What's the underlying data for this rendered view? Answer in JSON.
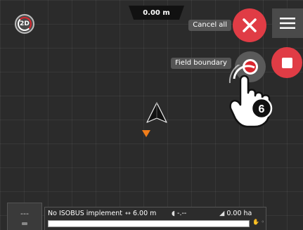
{
  "top": {
    "mode_label": "2D",
    "distance": "0.00 m"
  },
  "actions": {
    "cancel_label": "Cancel all",
    "field_boundary_label": "Field boundary",
    "step_badge": "6"
  },
  "left_panel": {
    "value": "---"
  },
  "status_bar": {
    "implement": "No ISOBUS implement",
    "width": "6.00 m",
    "rate": "-.--",
    "area": "0.00 ha",
    "progress": 0.0
  },
  "colors": {
    "accent_red": "#e03c45",
    "vehicle_marker": "#f07d1a"
  },
  "icons": [
    "2d-mode-icon",
    "close-icon",
    "menu-icon",
    "record-icon",
    "stop-icon",
    "hand-pointer-icon",
    "vehicle-arrow-icon",
    "width-icon",
    "rate-icon",
    "area-icon"
  ]
}
